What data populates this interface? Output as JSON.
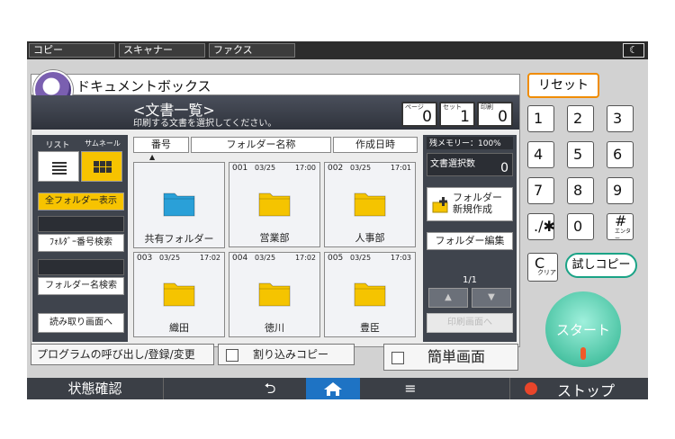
{
  "mode_tabs": [
    "コピー",
    "スキャナー",
    "ファクス"
  ],
  "night_icon": "moon-icon",
  "app": {
    "title": "ドキュメントボックス",
    "list_title": "<文書一覧>",
    "list_subtitle": "印刷する文書を選択してください。",
    "counters": [
      {
        "label": "ページ",
        "value": "0"
      },
      {
        "label": "セット",
        "value": "1"
      },
      {
        "label": "印刷",
        "value": "0"
      }
    ]
  },
  "left": {
    "view_list_label": "リスト",
    "view_thumb_label": "サムネール",
    "show_all_label": "全フォルダー表示",
    "folder_num_search": "ﾌｫﾙﾀﾞｰ番号検索",
    "folder_name_search": "フォルダー名検索",
    "to_read_screen": "読み取り画面へ"
  },
  "columns": [
    "番号",
    "フォルダー名称",
    "作成日時"
  ],
  "folders": [
    {
      "num": "",
      "date": "",
      "time": "",
      "name": "共有フォルダー",
      "color": "#2aa0d8"
    },
    {
      "num": "001",
      "date": "03/25",
      "time": "17:00",
      "name": "営業部",
      "color": "#f5c400"
    },
    {
      "num": "002",
      "date": "03/25",
      "time": "17:01",
      "name": "人事部",
      "color": "#f5c400"
    },
    {
      "num": "003",
      "date": "03/25",
      "time": "17:02",
      "name": "織田",
      "color": "#f5c400"
    },
    {
      "num": "004",
      "date": "03/25",
      "time": "17:02",
      "name": "徳川",
      "color": "#f5c400"
    },
    {
      "num": "005",
      "date": "03/25",
      "time": "17:03",
      "name": "豊臣",
      "color": "#f5c400"
    }
  ],
  "right": {
    "remaining_memory": "残メモリー：100%",
    "selected_docs_label": "文書選択数",
    "selected_docs_value": "0",
    "new_folder": "フォルダー\n新規作成",
    "edit_folder": "フォルダー編集",
    "page_indicator": "1/1",
    "to_print_screen": "印刷画面へ"
  },
  "keypad": {
    "reset": "リセット",
    "keys": [
      "1",
      "2",
      "3",
      "4",
      "5",
      "6",
      "7",
      "8",
      "9",
      ".∕✱",
      "0",
      "#"
    ],
    "enter_sub": "エンター",
    "clear": "C",
    "clear_sub": "クリア",
    "trial_copy": "試しコピー",
    "start": "スタート"
  },
  "bottom": {
    "program": "プログラムの呼び出し/登録/変更",
    "interrupt": "割り込みコピー",
    "simple": "簡単画面"
  },
  "statusbar": {
    "status_check": "状態確認",
    "stop": "ストップ"
  }
}
